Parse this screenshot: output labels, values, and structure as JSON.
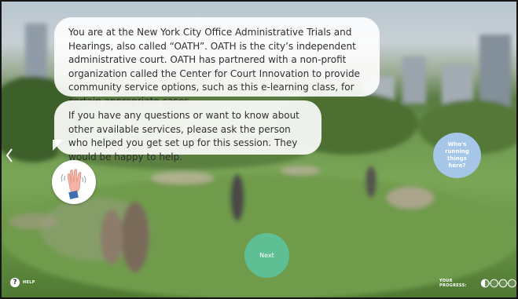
{
  "narration": {
    "main_text": "You are at the New York City Office Administrative Trials and Hearings, also called “OATH”. OATH is the city’s independent administrative court. OATH has partnered with a non-profit organization called the Center for Court Innovation to provide community service options, such as this e-learning class, for certain appropriate cases.",
    "secondary_text": "If you have any questions or want to know about other available services, please ask the person who helped you get set up for this session. They would be happy to help."
  },
  "side_question": {
    "label": "Who's running things here?"
  },
  "navigation": {
    "next_label": "Next",
    "back_icon": "chevron-left-icon"
  },
  "footer": {
    "help_label": "HELP",
    "help_icon": "question-mark-icon",
    "progress_label": "YOUR PROGRESS:",
    "progress": {
      "current_step": 1,
      "total_steps": 4,
      "fraction": 0.25
    }
  },
  "avatar": {
    "icon": "waving-hand-icon"
  },
  "colors": {
    "next_button": "#5fbf94",
    "side_question": "#a5c6e6",
    "bubble": "#ffffff",
    "text": "#2f2f2f"
  }
}
